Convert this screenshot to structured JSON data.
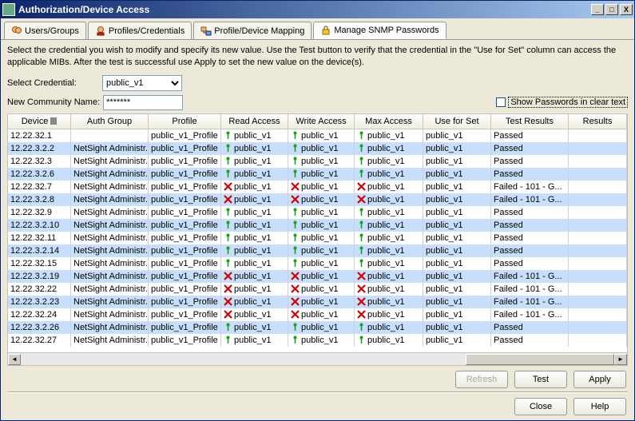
{
  "title": "Authorization/Device Access",
  "tabs": [
    {
      "label": "Users/Groups"
    },
    {
      "label": "Profiles/Credentials"
    },
    {
      "label": "Profile/Device Mapping"
    },
    {
      "label": "Manage SNMP Passwords"
    }
  ],
  "active_tab": 3,
  "instructions": "Select the credential you wish to modify and specify its new value.  Use the Test button to verify that the credential in the \"Use for Set\" column can access the applicable MIBs.  After the test is successful use Apply to set the new value on the device(s).",
  "form": {
    "select_credential_label": "Select Credential:",
    "select_credential_value": "public_v1",
    "new_name_label": "New Community Name:",
    "new_name_value": "*******",
    "show_passwords_label": "Show Passwords in clear text"
  },
  "columns": [
    "Device",
    "Auth Group",
    "Profile",
    "Read Access",
    "Write Access",
    "Max Access",
    "Use for Set",
    "Test Results",
    "Results"
  ],
  "rows": [
    {
      "dev": "12.22.32.1",
      "auth": "",
      "ok": true,
      "test": "Passed"
    },
    {
      "dev": "12.22.3.2.2",
      "auth": "NetSight Administr...",
      "ok": true,
      "test": "Passed"
    },
    {
      "dev": "12.22.32.3",
      "auth": "NetSight Administr...",
      "ok": true,
      "test": "Passed"
    },
    {
      "dev": "12.22.3.2.6",
      "auth": "NetSight Administr...",
      "ok": true,
      "test": "Passed"
    },
    {
      "dev": "12.22.32.7",
      "auth": "NetSight Administr...",
      "ok": false,
      "test": "Failed - 101 - G..."
    },
    {
      "dev": "12.22.3.2.8",
      "auth": "NetSight Administr...",
      "ok": false,
      "test": "Failed - 101 - G..."
    },
    {
      "dev": "12.22.32.9",
      "auth": "NetSight Administr...",
      "ok": true,
      "test": "Passed"
    },
    {
      "dev": "12.22.3.2.10",
      "auth": "NetSight Administr...",
      "ok": true,
      "test": "Passed"
    },
    {
      "dev": "12.22.32.11",
      "auth": "NetSight Administr...",
      "ok": true,
      "test": "Passed"
    },
    {
      "dev": "12.22.3.2.14",
      "auth": "NetSight Administr...",
      "ok": true,
      "test": "Passed"
    },
    {
      "dev": "12.22.32.15",
      "auth": "NetSight Administr...",
      "ok": true,
      "test": "Passed"
    },
    {
      "dev": "12.22.3.2.19",
      "auth": "NetSight Administr...",
      "ok": false,
      "test": "Failed - 101 - G..."
    },
    {
      "dev": "12.22.32.22",
      "auth": "NetSight Administr...",
      "ok": false,
      "test": "Failed - 101 - G..."
    },
    {
      "dev": "12.22.3.2.23",
      "auth": "NetSight Administr...",
      "ok": false,
      "test": "Failed - 101 - G..."
    },
    {
      "dev": "12.22.32.24",
      "auth": "NetSight Administr...",
      "ok": false,
      "test": "Failed - 101 - G..."
    },
    {
      "dev": "12.22.3.2.26",
      "auth": "NetSight Administr...",
      "ok": true,
      "test": "Passed"
    },
    {
      "dev": "12.22.32.27",
      "auth": "NetSight Administr...",
      "ok": true,
      "test": "Passed"
    }
  ],
  "profile": "public_v1_Profile",
  "cred": "public_v1",
  "buttons": {
    "refresh": "Refresh",
    "test": "Test",
    "apply": "Apply",
    "close": "Close",
    "help": "Help"
  }
}
